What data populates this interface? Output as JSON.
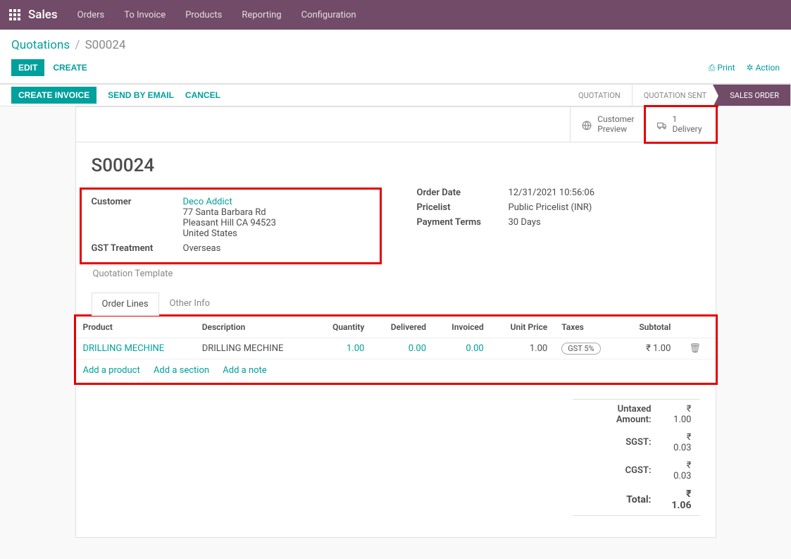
{
  "topbar": {
    "brand": "Sales",
    "menu": [
      "Orders",
      "To Invoice",
      "Products",
      "Reporting",
      "Configuration"
    ]
  },
  "breadcrumbs": {
    "parent": "Quotations",
    "current": "S00024"
  },
  "toolbar": {
    "edit": "EDIT",
    "create": "CREATE",
    "print": "Print",
    "action": "Action"
  },
  "statusbar": {
    "create_invoice": "CREATE INVOICE",
    "send_email": "SEND BY EMAIL",
    "cancel": "CANCEL",
    "steps": [
      "QUOTATION",
      "QUOTATION SENT",
      "SALES ORDER"
    ]
  },
  "button_box": {
    "customer_preview": "Customer\nPreview",
    "delivery_count": "1",
    "delivery_label": "Delivery"
  },
  "record": {
    "title": "S00024",
    "customer_label": "Customer",
    "customer_name": "Deco Addict",
    "customer_addr1": "77 Santa Barbara Rd",
    "customer_addr2": "Pleasant Hill CA 94523",
    "customer_addr3": "United States",
    "gst_label": "GST Treatment",
    "gst_value": "Overseas",
    "quotation_template": "Quotation Template",
    "orderdate_label": "Order Date",
    "orderdate_value": "12/31/2021 10:56:06",
    "pricelist_label": "Pricelist",
    "pricelist_value": "Public Pricelist (INR)",
    "payment_label": "Payment Terms",
    "payment_value": "30 Days"
  },
  "tabs": {
    "order_lines": "Order Lines",
    "other_info": "Other Info"
  },
  "table": {
    "headers": {
      "product": "Product",
      "description": "Description",
      "quantity": "Quantity",
      "delivered": "Delivered",
      "invoiced": "Invoiced",
      "unit_price": "Unit Price",
      "taxes": "Taxes",
      "subtotal": "Subtotal"
    },
    "row": {
      "product": "DRILLING MECHINE",
      "description": "DRILLING MECHINE",
      "quantity": "1.00",
      "delivered": "0.00",
      "invoiced": "0.00",
      "unit_price": "1.00",
      "taxes": "GST 5%",
      "subtotal": "₹ 1.00"
    },
    "add_product": "Add a product",
    "add_section": "Add a section",
    "add_note": "Add a note"
  },
  "totals": {
    "untaxed_label": "Untaxed Amount:",
    "untaxed_value": "₹ 1.00",
    "sgst_label": "SGST:",
    "sgst_value": "₹ 0.03",
    "cgst_label": "CGST:",
    "cgst_value": "₹ 0.03",
    "total_label": "Total:",
    "total_value": "₹ 1.06"
  }
}
